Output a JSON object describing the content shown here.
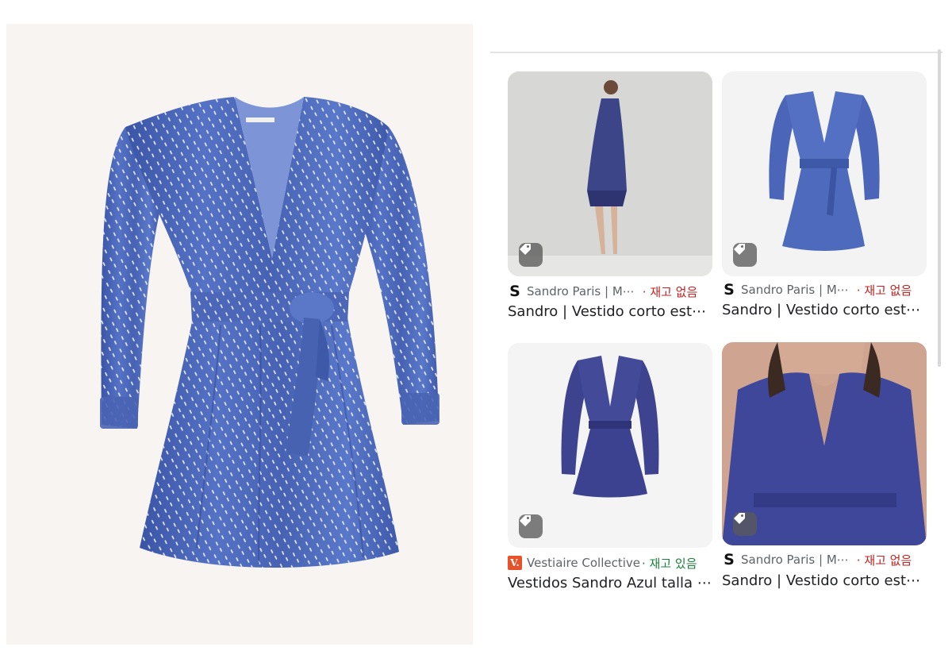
{
  "results": [
    {
      "source_icon": "sandro-logo-icon",
      "source_initial": "S",
      "source": "Sandro Paris | M⋯",
      "stock": "· 재고 없음",
      "title": "Sandro | Vestido corto est⋯"
    },
    {
      "source_icon": "sandro-logo-icon",
      "source_initial": "S",
      "source": "Sandro Paris | M⋯",
      "stock": "· 재고 없음",
      "title": "Sandro | Vestido corto est⋯"
    },
    {
      "source_icon": "vestiaire-logo-icon",
      "source_initial": "V.",
      "source": "Vestiaire Collective",
      "stock": "· 재고 있음",
      "title": "Vestidos Sandro Azul talla ⋯"
    },
    {
      "source_icon": "sandro-logo-icon",
      "source_initial": "S",
      "source": "Sandro Paris | M⋯",
      "stock": "· 재고 없음",
      "title": "Sandro | Vestido corto est⋯"
    }
  ],
  "colors": {
    "out_of_stock": "#c5221f",
    "in_stock": "#188038",
    "dress_blue": "#4a64b4",
    "dress_navy": "#3a3f86"
  }
}
